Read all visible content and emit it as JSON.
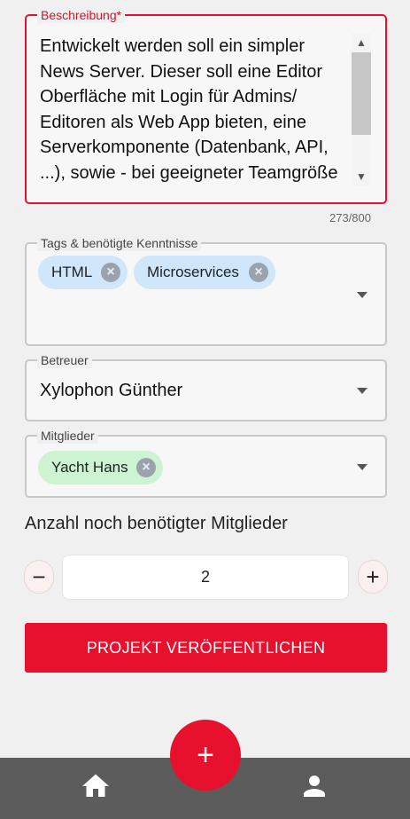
{
  "description": {
    "label": "Beschreibung*",
    "value": "Entwickelt werden soll ein simpler News Server. Dieser soll eine Editor Oberfläche mit Login für Admins/ Editoren als Web App bieten, eine Serverkomponente (Datenbank, API, ...), sowie - bei geeigneter Teamgröße",
    "char_count": "273/800"
  },
  "tags": {
    "label": "Tags & benötigte Kenntnisse",
    "chips": [
      "HTML",
      "Microservices"
    ]
  },
  "supervisor": {
    "label": "Betreuer",
    "value": "Xylophon Günther"
  },
  "members": {
    "label": "Mitglieder",
    "chips": [
      "Yacht Hans"
    ]
  },
  "needed_members": {
    "title": "Anzahl noch benötigter Mitglieder",
    "value": "2",
    "decrement": "−",
    "increment": "+"
  },
  "publish_button": "PROJEKT VERÖFFENTLICHEN",
  "fab_label": "+",
  "colors": {
    "accent": "#e8112d",
    "chip_blue": "#cfe6fb",
    "chip_green": "#cdf3d2",
    "bottom_bar": "#5c5c5c"
  },
  "icons": {
    "home": "home-icon",
    "profile": "person-icon",
    "add": "plus-icon",
    "chip_remove": "close-circle-icon",
    "dropdown": "chevron-down-icon"
  }
}
